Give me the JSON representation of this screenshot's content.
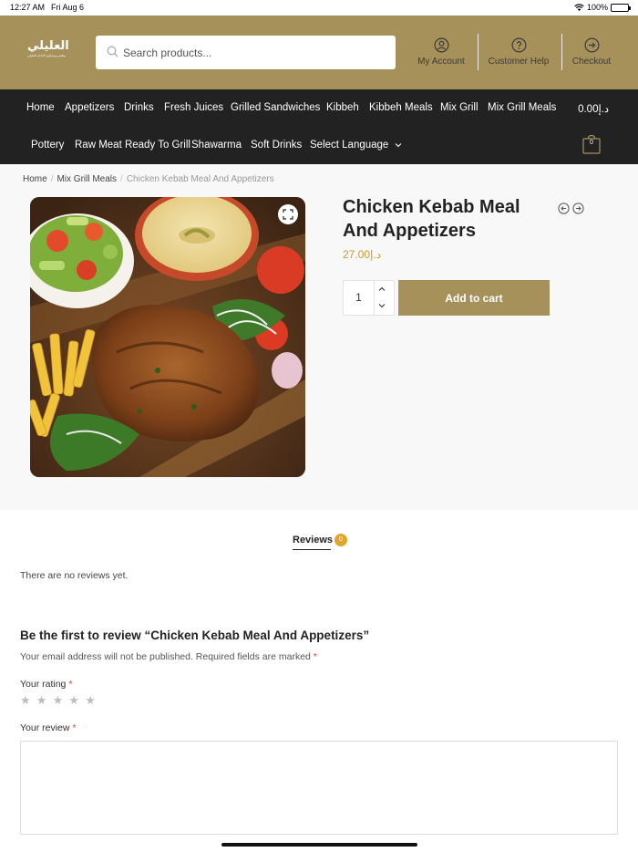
{
  "status": {
    "time": "12:27 AM",
    "date": "Fri Aug 6",
    "battery": "100%"
  },
  "header": {
    "logo_text": "العليلي",
    "logo_subtext": "مطعم ومشاوي اللحام العليلي",
    "search_placeholder": "Search products...",
    "links": [
      {
        "label": "My Account",
        "icon": "user-icon"
      },
      {
        "label": "Customer Help",
        "icon": "help-icon"
      },
      {
        "label": "Checkout",
        "icon": "arrow-right-circle-icon"
      }
    ],
    "brand_color": "#a7915b"
  },
  "nav": {
    "row1": [
      "Home",
      "Appetizers",
      "Drinks",
      "Fresh Juices",
      "Grilled Sandwiches",
      "Kibbeh",
      "Kibbeh Meals",
      "Mix Grill",
      "Mix Grill Meals"
    ],
    "row2": [
      "Pottery",
      "Raw Meat Ready To Grill",
      "Shawarma",
      "Soft Drinks",
      "Select Language"
    ],
    "cart_amount": "0.00د.إ",
    "cart_count": "0"
  },
  "breadcrumb": [
    "Home",
    "Mix Grill Meals",
    "Chicken Kebab Meal And Appetizers"
  ],
  "product": {
    "title": "Chicken Kebab Meal And Appetizers",
    "price": "27.00د.إ",
    "quantity": "1",
    "add_to_cart": "Add to cart",
    "price_color": "#c79a2e"
  },
  "reviews": {
    "tab_label": "Reviews",
    "count": "0",
    "empty_text": "There are no reviews yet.",
    "form_title": "Be the first to review “Chicken Kebab Meal And Appetizers”",
    "note": "Your email address will not be published. Required fields are marked",
    "required_mark": "*",
    "rating_label": "Your rating",
    "review_label": "Your review",
    "stars": [
      "★",
      "★",
      "★",
      "★",
      "★"
    ]
  }
}
